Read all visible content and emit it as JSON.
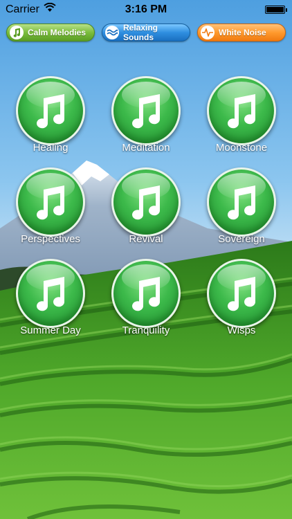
{
  "status_bar": {
    "carrier": "Carrier",
    "time": "3:16 PM",
    "battery_level": 1.0
  },
  "tabs": [
    {
      "label": "Calm Melodies",
      "icon": "music-note-icon",
      "color": "#7bbd3d"
    },
    {
      "label": "Relaxing Sounds",
      "icon": "waves-icon",
      "color": "#2f8fe0"
    },
    {
      "label": "White Noise",
      "icon": "pulse-icon",
      "color": "#ff9a2e"
    }
  ],
  "tracks": [
    {
      "label": "Healing"
    },
    {
      "label": "Meditation"
    },
    {
      "label": "Moonstone"
    },
    {
      "label": "Perspectives"
    },
    {
      "label": "Revival"
    },
    {
      "label": "Sovereign"
    },
    {
      "label": "Summer Day"
    },
    {
      "label": "Tranquility"
    },
    {
      "label": "Wisps"
    }
  ],
  "colors": {
    "button_green": "#3cb94a",
    "sky": "#8fc7ef",
    "field": "#2f8a1c"
  }
}
